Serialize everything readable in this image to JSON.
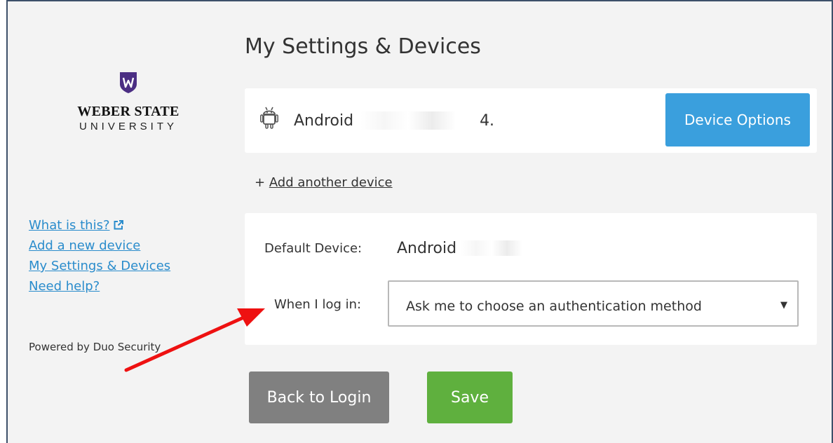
{
  "page": {
    "title": "My Settings & Devices"
  },
  "logo": {
    "line1": "WEBER STATE",
    "line2": "UNIVERSITY",
    "brand_color": "#4b2e83"
  },
  "sidebar": {
    "links": [
      {
        "label": "What is this?",
        "icon": "external-link-icon"
      },
      {
        "label": "Add a new device"
      },
      {
        "label": "My Settings & Devices"
      },
      {
        "label": "Need help?"
      }
    ],
    "powered_by": "Powered by Duo Security"
  },
  "device": {
    "icon": "android-icon",
    "name": "Android",
    "options_label": "Device Options",
    "suffix": "4."
  },
  "add_device": {
    "prefix": "+ ",
    "link_label": "Add another device"
  },
  "settings": {
    "default_device_label": "Default Device:",
    "default_device_value": "Android",
    "login_label": "When I log in:",
    "login_select_value": "Ask me to choose an authentication method"
  },
  "buttons": {
    "back_label": "Back to Login",
    "save_label": "Save"
  },
  "colors": {
    "accent_blue": "#3a9fdd",
    "save_green": "#5fb03e",
    "back_gray": "#808080",
    "link_blue": "#2a8ccc",
    "annotation_arrow": "#ee1111"
  }
}
